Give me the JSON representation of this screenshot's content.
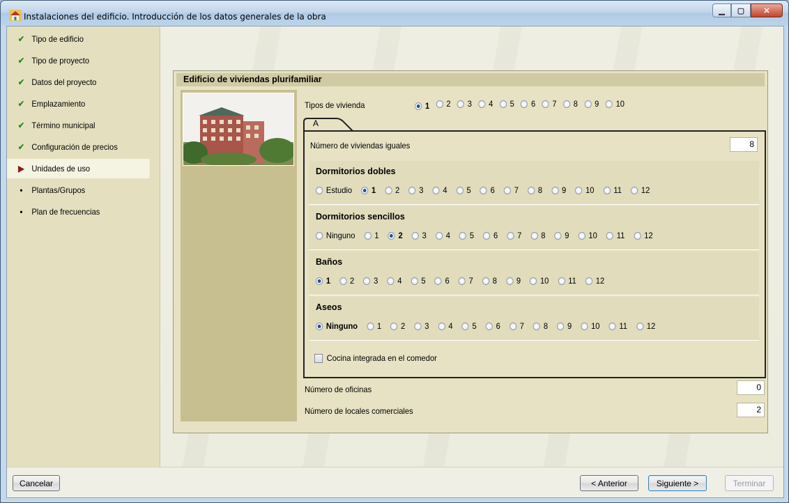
{
  "window": {
    "title": "Instalaciones del edificio. Introducción de los datos generales de la obra",
    "icon": "house-icon"
  },
  "sidebar": {
    "items": [
      {
        "label": "Tipo de edificio",
        "state": "done"
      },
      {
        "label": "Tipo de proyecto",
        "state": "done"
      },
      {
        "label": "Datos del proyecto",
        "state": "done"
      },
      {
        "label": "Emplazamiento",
        "state": "done"
      },
      {
        "label": "Término municipal",
        "state": "done"
      },
      {
        "label": "Configuración de precios",
        "state": "done"
      },
      {
        "label": "Unidades de uso",
        "state": "current"
      },
      {
        "label": "Plantas/Grupos",
        "state": "pending"
      },
      {
        "label": "Plan de frecuencias",
        "state": "pending"
      }
    ]
  },
  "panel": {
    "title": "Edificio de viviendas plurifamiliar",
    "tipos_label": "Tipos de vivienda",
    "tipos_options": [
      "1",
      "2",
      "3",
      "4",
      "5",
      "6",
      "7",
      "8",
      "9",
      "10"
    ],
    "tipos_selected": 0,
    "tab_label": "A",
    "num_viviendas_label": "Número de viviendas iguales",
    "num_viviendas_value": "8",
    "dobles": {
      "title": "Dormitorios dobles",
      "options": [
        "Estudio",
        "1",
        "2",
        "3",
        "4",
        "5",
        "6",
        "7",
        "8",
        "9",
        "10",
        "11",
        "12"
      ],
      "selected": 1
    },
    "sencillos": {
      "title": "Dormitorios sencillos",
      "options": [
        "Ninguno",
        "1",
        "2",
        "3",
        "4",
        "5",
        "6",
        "7",
        "8",
        "9",
        "10",
        "11",
        "12"
      ],
      "selected": 2
    },
    "banos": {
      "title": "Baños",
      "options": [
        "1",
        "2",
        "3",
        "4",
        "5",
        "6",
        "7",
        "8",
        "9",
        "10",
        "11",
        "12"
      ],
      "selected": 0
    },
    "aseos": {
      "title": "Aseos",
      "options": [
        "Ninguno",
        "1",
        "2",
        "3",
        "4",
        "5",
        "6",
        "7",
        "8",
        "9",
        "10",
        "11",
        "12"
      ],
      "selected": 0
    },
    "cocina_label": "Cocina integrada en el comedor",
    "cocina_checked": false,
    "oficinas_label": "Número de oficinas",
    "oficinas_value": "0",
    "locales_label": "Número de locales comerciales",
    "locales_value": "2"
  },
  "buttons": {
    "cancel": "Cancelar",
    "back": "< Anterior",
    "next": "Siguiente >",
    "finish": "Terminar"
  },
  "colors": {
    "check": "#2f8a1e",
    "current_arrow": "#8b1a1a",
    "radio_selected": "#1f4f9a"
  }
}
